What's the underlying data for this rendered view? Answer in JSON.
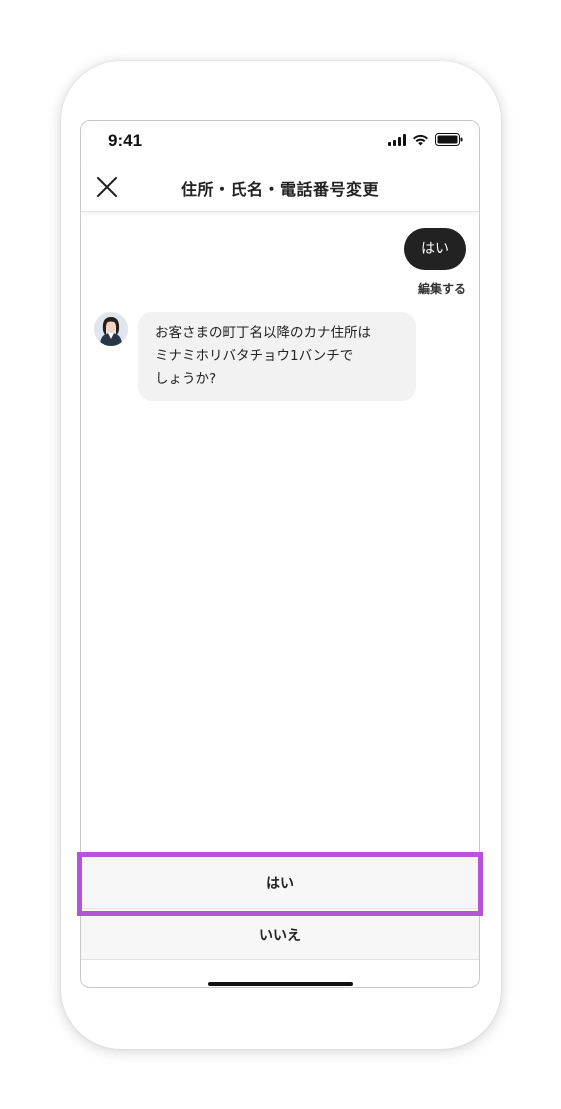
{
  "status_bar": {
    "time": "9:41"
  },
  "header": {
    "title": "住所・氏名・電話番号変更"
  },
  "chat": {
    "user_message": "はい",
    "edit_label": "編集する",
    "bot_message": "お客さまの町丁名以降のカナ住所は\nミナミホリバタチョウ1バンチで\nしょうか?"
  },
  "options": {
    "yes_label": "はい",
    "no_label": "いいえ"
  },
  "colors": {
    "highlight": "#b554d6",
    "user_bubble": "#222222",
    "bot_bubble": "#f2f2f2"
  },
  "icons": [
    "close-icon",
    "signal-icon",
    "wifi-icon",
    "battery-icon",
    "avatar"
  ]
}
